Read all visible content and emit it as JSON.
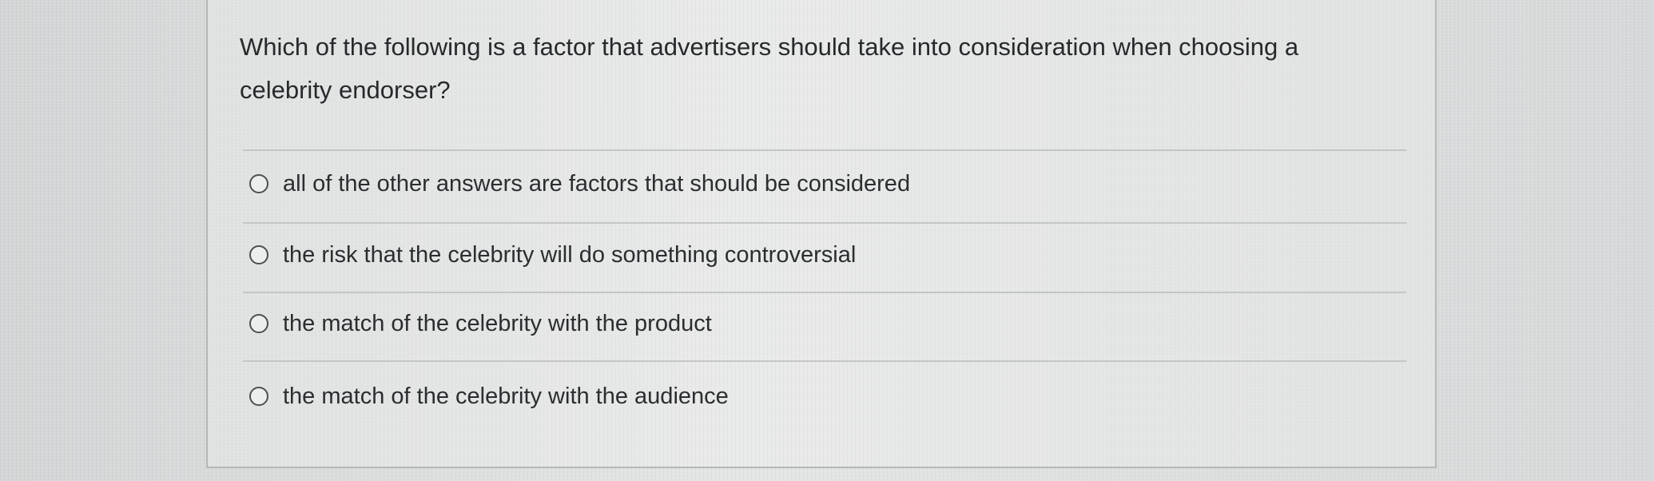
{
  "question": {
    "text": "Which of the following is a factor that advertisers should take into consideration when choosing a celebrity endorser?"
  },
  "options": [
    {
      "label": "all of the other answers are factors that should be considered",
      "selected": false
    },
    {
      "label": "the risk that the celebrity will do something controversial",
      "selected": false
    },
    {
      "label": "the match of the celebrity with the product",
      "selected": false
    },
    {
      "label": "the match of the celebrity with the audience",
      "selected": false
    }
  ]
}
